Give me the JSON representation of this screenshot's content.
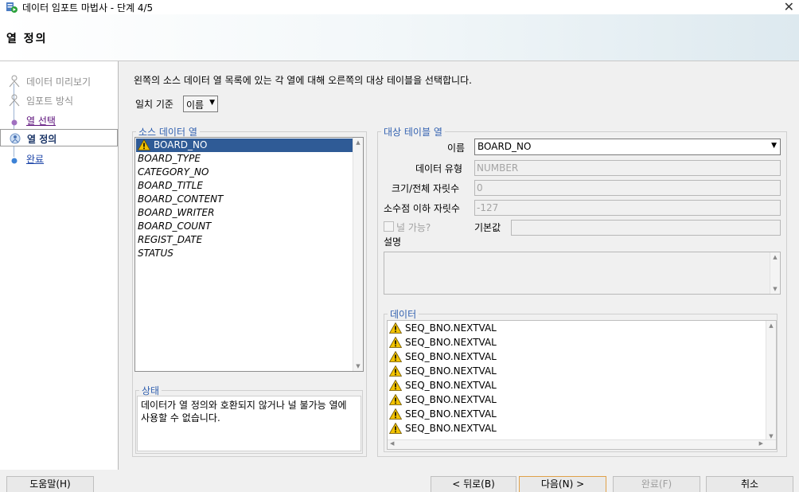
{
  "window": {
    "title": "데이터 임포트 마법사 - 단계 4/5",
    "close_glyph": "✕"
  },
  "header": {
    "heading": "열 정의"
  },
  "steps": [
    {
      "label": "데이터 미리보기",
      "state": "disabled"
    },
    {
      "label": "임포트 방식",
      "state": "disabled"
    },
    {
      "label": "열 선택",
      "state": "link"
    },
    {
      "label": "열 정의",
      "state": "current"
    },
    {
      "label": "완료",
      "state": "link"
    }
  ],
  "main": {
    "instruction": "왼쪽의 소스 데이터 열 목록에 있는 각 열에 대해 오른쪽의 대상 테이블을 선택합니다.",
    "match_label": "일치 기준",
    "match_value": "이름"
  },
  "source": {
    "legend": "소스 데이터 열",
    "columns": [
      "BOARD_NO",
      "BOARD_TYPE",
      "CATEGORY_NO",
      "BOARD_TITLE",
      "BOARD_CONTENT",
      "BOARD_WRITER",
      "BOARD_COUNT",
      "REGIST_DATE",
      "STATUS"
    ]
  },
  "status": {
    "legend": "상태",
    "text": "데이터가 열 정의와 호환되지 않거나 널 불가능 열에 사용할 수 없습니다."
  },
  "target": {
    "legend": "대상 테이블 열",
    "name_label": "이름",
    "name_value": "BOARD_NO",
    "type_label": "데이터 유형",
    "type_value": "NUMBER",
    "size_label": "크기/전체 자릿수",
    "size_value": "0",
    "scale_label": "소수점 이하 자릿수",
    "scale_value": "-127",
    "nullable_label": "널 가능?",
    "default_label": "기본값",
    "default_value": "",
    "comment_label": "설명",
    "data_legend": "데이터",
    "data_rows": [
      "SEQ_BNO.NEXTVAL",
      "SEQ_BNO.NEXTVAL",
      "SEQ_BNO.NEXTVAL",
      "SEQ_BNO.NEXTVAL",
      "SEQ_BNO.NEXTVAL",
      "SEQ_BNO.NEXTVAL",
      "SEQ_BNO.NEXTVAL",
      "SEQ_BNO.NEXTVAL"
    ]
  },
  "buttons": {
    "help": "도움말(H)",
    "back": "< 뒤로(B)",
    "next": "다음(N) >",
    "finish": "완료(F)",
    "cancel": "취소"
  },
  "colors": {
    "accent": "#2f5b96",
    "legend": "#3261b0",
    "warning": "#f3c300"
  }
}
